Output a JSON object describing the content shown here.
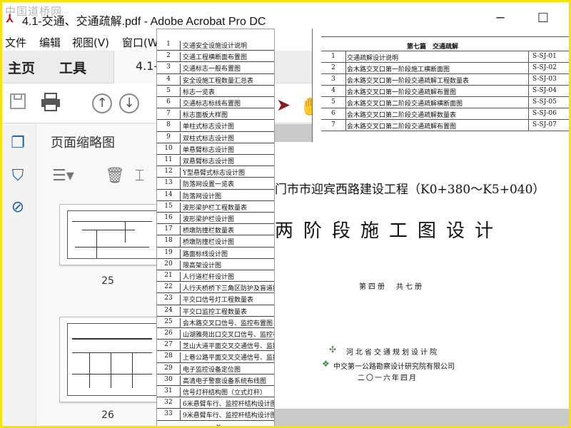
{
  "window": {
    "watermark": "中国道桥网",
    "title": "4.1-交通、交通疏解.pdf - Adobe Acrobat Pro DC",
    "minimize": "─",
    "maximize": "☐",
    "close": "✕"
  },
  "menu": [
    "文件",
    "编辑",
    "视图(V)",
    "窗口(W"
  ],
  "tabs": {
    "home": "主页",
    "tools": "工具",
    "doc": "4.1-"
  },
  "panel": {
    "title": "页面缩略图",
    "thumbs": [
      {
        "label": "25"
      },
      {
        "label": "26"
      }
    ]
  },
  "toc": {
    "rows": [
      {
        "no": "1",
        "name": "交通安全设施设计说明"
      },
      {
        "no": "2",
        "name": "交通工程横断面布置图"
      },
      {
        "no": "3",
        "name": "交通标志一般布置图"
      },
      {
        "no": "4",
        "name": "安全设施工程数量汇总表"
      },
      {
        "no": "5",
        "name": "标志一览表"
      },
      {
        "no": "6",
        "name": "交通标志标线布置图"
      },
      {
        "no": "7",
        "name": "标志面板大样图"
      },
      {
        "no": "8",
        "name": "单柱式标志设计图"
      },
      {
        "no": "9",
        "name": "双柱式标志设计图"
      },
      {
        "no": "10",
        "name": "单悬臂标志设计图"
      },
      {
        "no": "11",
        "name": "双悬臂标志设计图"
      },
      {
        "no": "12",
        "name": "Y型悬臂式标志设计图"
      },
      {
        "no": "13",
        "name": "防落网设置一览表"
      },
      {
        "no": "14",
        "name": "防落网设计图"
      },
      {
        "no": "15",
        "name": "波形梁护栏工程数量表"
      },
      {
        "no": "16",
        "name": "波形梁护栏设计图"
      },
      {
        "no": "17",
        "name": "桥墩防撞栏数量表"
      },
      {
        "no": "18",
        "name": "桥墩防撞栏设计图"
      },
      {
        "no": "19",
        "name": "路面标线设计图"
      },
      {
        "no": "20",
        "name": "限高架设计图"
      },
      {
        "no": "21",
        "name": "人行道栏杆设计图"
      },
      {
        "no": "22",
        "name": "人行天桥桥下三角区防护及盲道措"
      },
      {
        "no": "23",
        "name": "平交口信号灯工程数量表"
      },
      {
        "no": "24",
        "name": "平交口监控工程数量表"
      },
      {
        "no": "25",
        "name": "会木路交叉口信号、监控布置图"
      },
      {
        "no": "26",
        "name": "山湖雅苑出口交叉口信号、监控布"
      },
      {
        "no": "27",
        "name": "芝山大道平面交叉交通信号、监控"
      },
      {
        "no": "28",
        "name": "上巷公路平面交叉交通信号、监控"
      },
      {
        "no": "29",
        "name": "电子监控设备定位图"
      },
      {
        "no": "30",
        "name": "高清电子警察设备系统布线图"
      },
      {
        "no": "31",
        "name": "信号灯杆结构图（立式灯杆）"
      },
      {
        "no": "32",
        "name": "6米悬臂车行、监控杆结构设计图"
      },
      {
        "no": "33",
        "name": "9米悬臂车行、监控杆结构设计图"
      }
    ]
  },
  "section7": {
    "header": "第七篇　交通疏解",
    "rows": [
      {
        "no": "1",
        "name": "交通疏解设计说明",
        "code": "S-SJ-01"
      },
      {
        "no": "2",
        "name": "会木路交叉口第一阶段施工横断面图",
        "code": "S-SJ-02"
      },
      {
        "no": "3",
        "name": "会木路交叉口第一阶段交通疏解工程数量表",
        "code": "S-SJ-03"
      },
      {
        "no": "4",
        "name": "会木路交叉口第一阶段交通疏解布置图",
        "code": "S-SJ-04"
      },
      {
        "no": "5",
        "name": "会木路交叉口第二阶段交通疏解横断面图",
        "code": "S-SJ-05"
      },
      {
        "no": "6",
        "name": "会木路交叉口第二阶段交通疏解数量表",
        "code": "S-SJ-06"
      },
      {
        "no": "7",
        "name": "会木路交叉口第二阶段交通疏解布置图",
        "code": "S-SJ-07"
      }
    ]
  },
  "cover": {
    "project": "门市市迎宾西路建设工程（K0+380～K5+040）",
    "stage": "两阶段施工图设计",
    "volume": "第四册　共七册",
    "inst1": "河北省交通规划设计院",
    "inst2": "中交第一公路勘察设计研究院有限公司",
    "date": "二〇一六年四月"
  }
}
